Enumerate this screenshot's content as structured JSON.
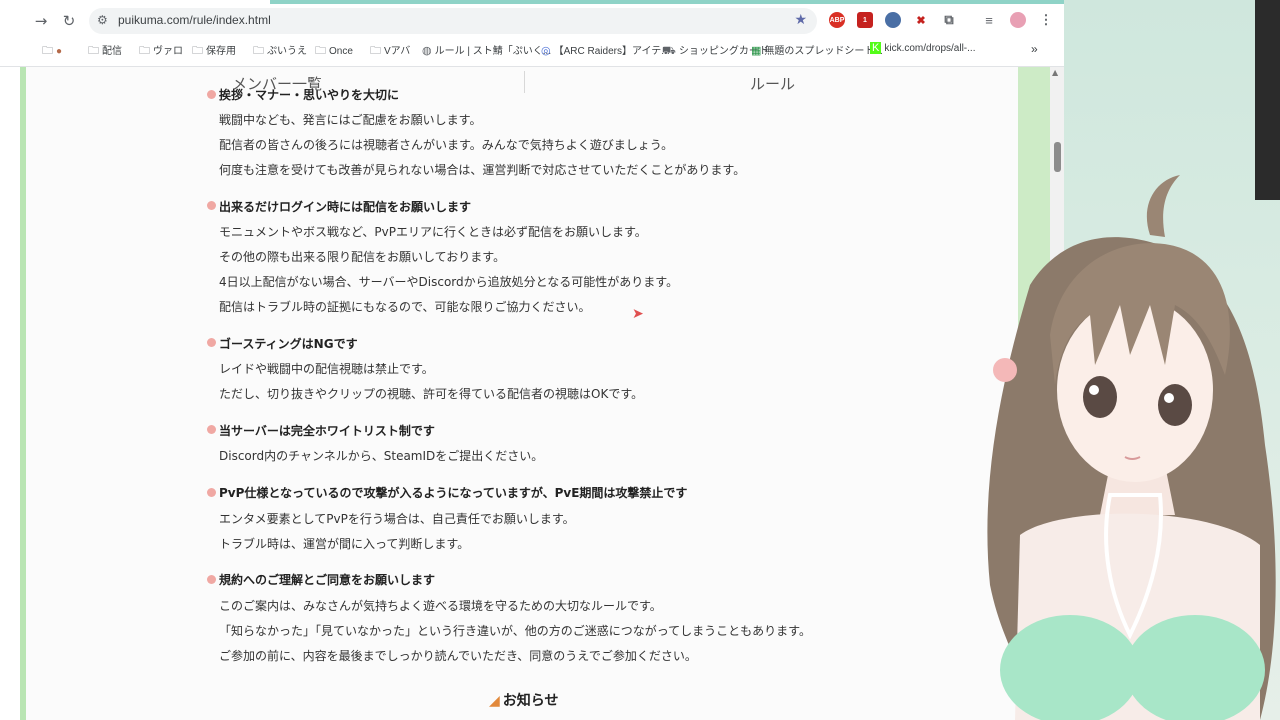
{
  "browser": {
    "url": "puikuma.com/rule/index.html",
    "bookmarks": [
      {
        "label": "",
        "icon": "folder-icon"
      },
      {
        "label": "配信",
        "icon": "folder-icon"
      },
      {
        "label": "ヴァロ",
        "icon": "folder-icon"
      },
      {
        "label": "保存用",
        "icon": "folder-icon"
      },
      {
        "label": "ぷいうえ",
        "icon": "folder-icon"
      },
      {
        "label": "Once",
        "icon": "folder-icon"
      },
      {
        "label": "Vアバ",
        "icon": "folder-icon"
      },
      {
        "label": "ルール | スト鯖「ぷいく...",
        "icon": "globe-icon"
      },
      {
        "label": "【ARC Raiders】アイテ...",
        "icon": "link-icon"
      },
      {
        "label": "ショッピングカート",
        "icon": "cart-icon"
      },
      {
        "label": "無題のスプレッドシート...",
        "icon": "sheets-icon"
      },
      {
        "label": "kick.com/drops/all-...",
        "icon": "kick-icon"
      }
    ],
    "extensions": [
      "ABP",
      "1",
      "",
      "",
      ""
    ]
  },
  "site_nav": {
    "members": "メンバー一覧",
    "rules": "ルール"
  },
  "rules": [
    {
      "title": "挨拶・マナー・思いやりを大切に",
      "lines": [
        "戦闘中なども、発言にはご配慮をお願いします。",
        "配信者の皆さんの後ろには視聴者さんがいます。みんなで気持ちよく遊びましょう。",
        "何度も注意を受けても改善が見られない場合は、運営判断で対応させていただくことがあります。"
      ]
    },
    {
      "title": "出来るだけログイン時には配信をお願いします",
      "lines": [
        "モニュメントやボス戦など、PvPエリアに行くときは必ず配信をお願いします。",
        "その他の際も出来る限り配信をお願いしております。",
        "4日以上配信がない場合、サーバーやDiscordから追放処分となる可能性があります。",
        "配信はトラブル時の証拠にもなるので、可能な限りご協力ください。"
      ]
    },
    {
      "title": "ゴースティングはNGです",
      "lines": [
        "レイドや戦闘中の配信視聴は禁止です。",
        "ただし、切り抜きやクリップの視聴、許可を得ている配信者の視聴はOKです。"
      ]
    },
    {
      "title": "当サーバーは完全ホワイトリスト制です",
      "lines": [
        "Discord内のチャンネルから、SteamIDをご提出ください。"
      ]
    },
    {
      "title": "PvP仕様となっているので攻撃が入るようになっていますが、PvE期間は攻撃禁止です",
      "lines": [
        "エンタメ要素としてPvPを行う場合は、自己責任でお願いします。",
        "トラブル時は、運営が間に入って判断します。"
      ]
    },
    {
      "title": "規約へのご理解とご同意をお願いします",
      "lines": [
        "このご案内は、みなさんが気持ちよく遊べる環境を守るための大切なルールです。",
        "「知らなかった」「見ていなかった」という行き違いが、他の方のご迷惑につながってしまうこともあります。",
        "ご参加の前に、内容を最後までしっかり読んでいただき、同意のうえでご参加ください。"
      ]
    }
  ],
  "notice": "お知らせ",
  "colors": {
    "accent_dot": "#f0a8a3",
    "green_border": "#b9e5b3",
    "notice_icon": "#e2893b"
  }
}
